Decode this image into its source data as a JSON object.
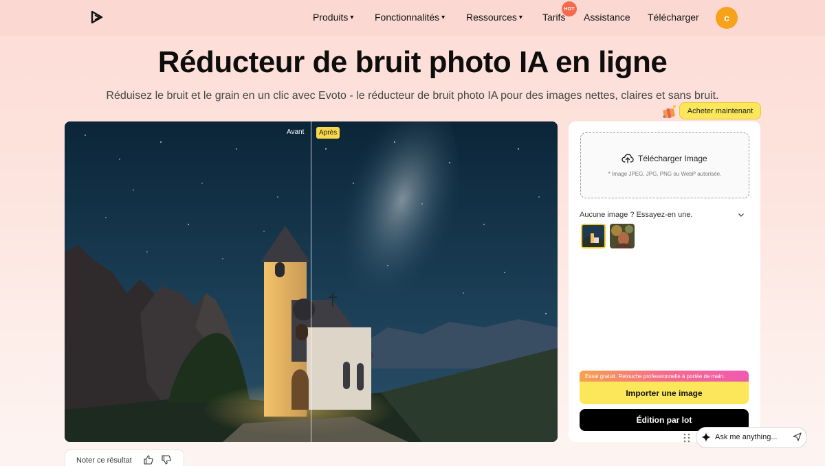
{
  "nav": {
    "items": [
      {
        "label": "Produits",
        "caret": "▾"
      },
      {
        "label": "Fonctionnalités",
        "caret": "▾"
      },
      {
        "label": "Ressources",
        "caret": "▾"
      },
      {
        "label": "Tarifs",
        "caret": ""
      },
      {
        "label": "Assistance",
        "caret": ""
      },
      {
        "label": "Télécharger",
        "caret": ""
      }
    ],
    "hot_badge": "HOT",
    "avatar_initial": "c"
  },
  "hero": {
    "title": "Réducteur de bruit photo IA en ligne",
    "subtitle": "Réduisez le bruit et le grain en un clic avec Evoto - le réducteur de bruit photo IA pour des images nettes, claires et sans bruit."
  },
  "buy": {
    "label": "Acheter maintenant"
  },
  "compare": {
    "before_label": "Avant",
    "after_label": "Après"
  },
  "upload": {
    "button_label": "Télécharger Image",
    "hint": "* Image JPEG, JPG, PNG ou WebP autorisée."
  },
  "samples": {
    "label": "Aucune image ? Essayez-en une."
  },
  "actions": {
    "promo_text": "Essai gratuit. Retouche professionnelle à portée de main.",
    "import_label": "Importer une image",
    "batch_label": "Édition par lot"
  },
  "ask": {
    "placeholder": "Ask me anything..."
  },
  "rating": {
    "label": "Noter ce résultat"
  },
  "colors": {
    "accent_yellow": "#fce65a",
    "header_bg": "#fbd8d2",
    "avatar": "#f6a21a",
    "hot": "#f36b4f"
  },
  "icons": [
    "app-logo-icon",
    "chevron-down-icon",
    "upload-cloud-icon",
    "sparkle-icon",
    "send-icon",
    "thumbs-up-icon",
    "thumbs-down-icon",
    "drag-handle-icon",
    "gift-box-icon"
  ]
}
